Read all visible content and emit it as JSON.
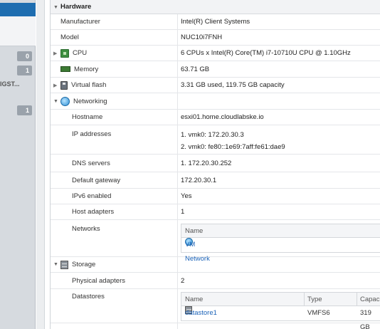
{
  "sidebar": {
    "badges": [
      "0",
      "1",
      "1"
    ],
    "truncated_text": "IGST..."
  },
  "hardware": {
    "title": "Hardware",
    "rows": [
      {
        "label": "Manufacturer",
        "value": "Intel(R) Client Systems"
      },
      {
        "label": "Model",
        "value": "NUC10i7FNH"
      },
      {
        "label": "CPU",
        "value": "6 CPUs x Intel(R) Core(TM) i7-10710U CPU @ 1.10GHz",
        "icon": "cpu-icon"
      },
      {
        "label": "Memory",
        "value": "63.71 GB",
        "icon": "memory-icon"
      },
      {
        "label": "Virtual flash",
        "value": "3.31 GB used, 119.75 GB capacity",
        "icon": "flash-icon"
      }
    ]
  },
  "networking": {
    "label": "Networking",
    "icon": "network-icon",
    "hostname_label": "Hostname",
    "hostname": "esxi01.home.cloudlabske.io",
    "ip_label": "IP addresses",
    "ip1": "1. vmk0: 172.20.30.3",
    "ip2": "2. vmk0: fe80::1e69:7aff:fe61:dae9",
    "dns_label": "DNS servers",
    "dns": "1. 172.20.30.252",
    "gateway_label": "Default gateway",
    "gateway": "172.20.30.1",
    "ipv6_label": "IPv6 enabled",
    "ipv6": "Yes",
    "adapters_label": "Host adapters",
    "adapters": "1",
    "networks_label": "Networks",
    "networks_table": {
      "header": "Name",
      "item": "VM Network"
    }
  },
  "storage": {
    "label": "Storage",
    "icon": "storage-icon",
    "physical_label": "Physical adapters",
    "physical": "2",
    "datastores_label": "Datastores",
    "datastores_table": {
      "headers": [
        "Name",
        "Type",
        "Capac"
      ],
      "name": "datastore1",
      "type": "VMFS6",
      "capacity": "319 GB"
    }
  }
}
